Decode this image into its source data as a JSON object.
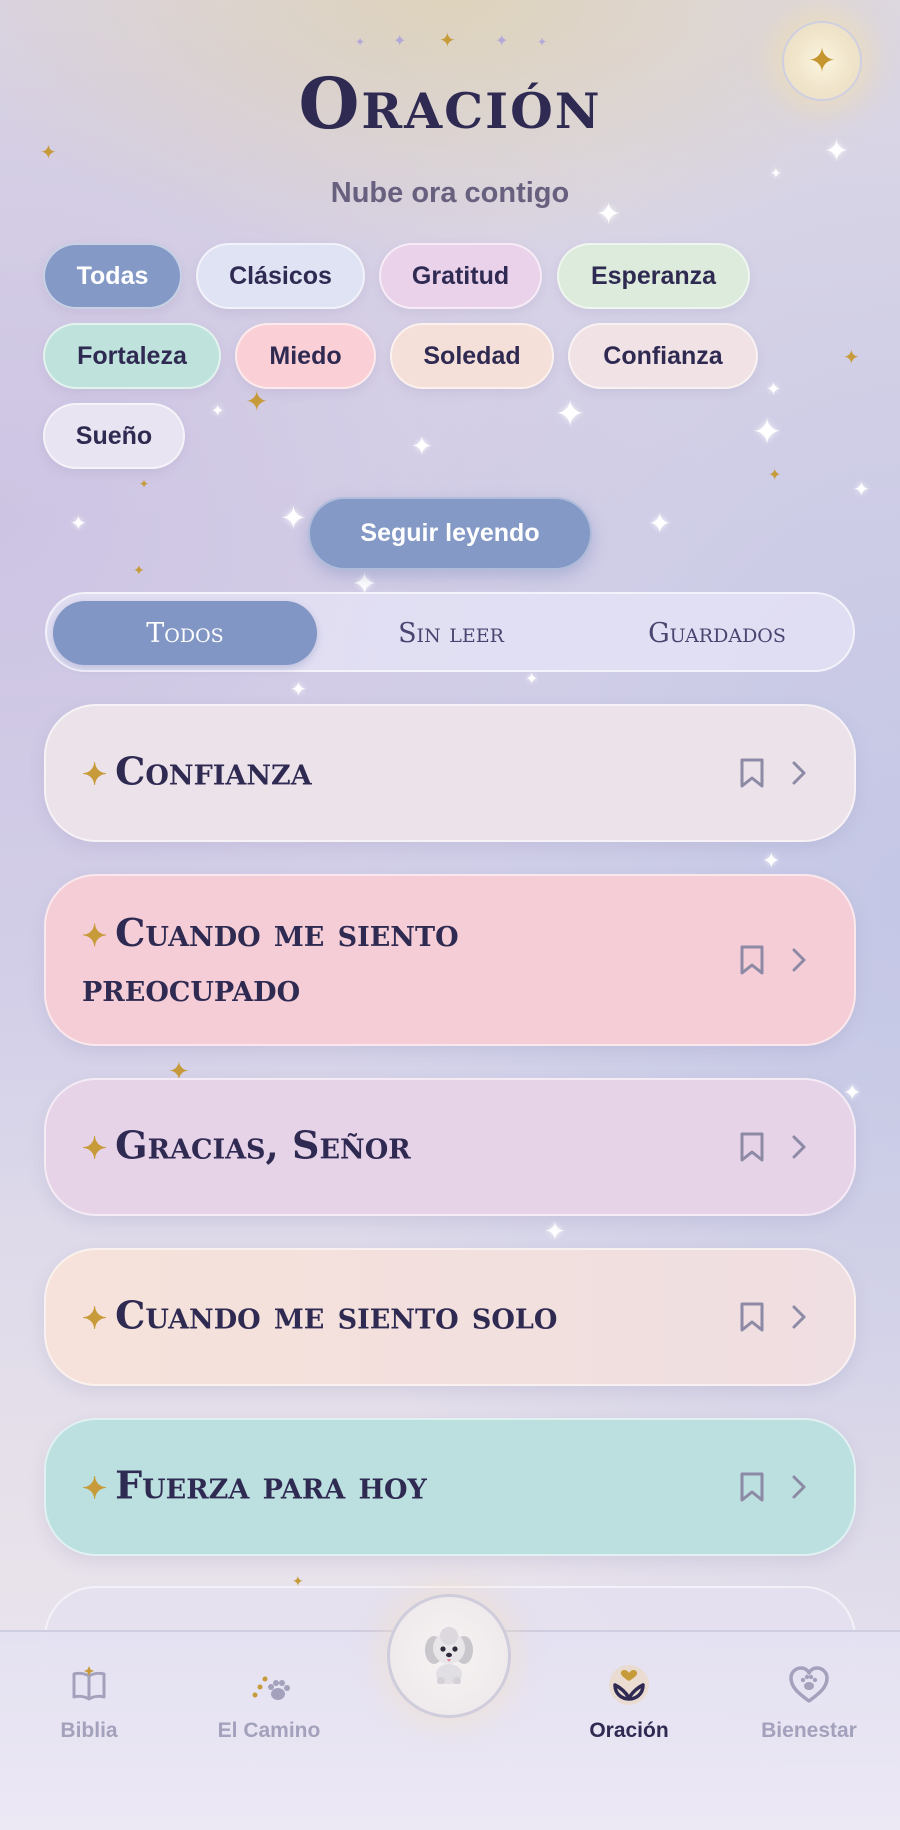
{
  "header": {
    "title": "Oración",
    "subtitle": "Nube ora contigo",
    "orb_icon": "sparkle-icon"
  },
  "filters": [
    {
      "label": "Todas",
      "color": "#8499c6",
      "active": true
    },
    {
      "label": "Clásicos",
      "color": "#dfe3f4",
      "active": false
    },
    {
      "label": "Gratitud",
      "color": "#ead2ea",
      "active": false
    },
    {
      "label": "Esperanza",
      "color": "#dcebdc",
      "active": false
    },
    {
      "label": "Fortaleza",
      "color": "#bfe3dc",
      "active": false
    },
    {
      "label": "Miedo",
      "color": "#fad0d6",
      "active": false
    },
    {
      "label": "Soledad",
      "color": "#f5dfd9",
      "active": false
    },
    {
      "label": "Confianza",
      "color": "#f1e2e5",
      "active": false
    },
    {
      "label": "Sueño",
      "color": "#e9e4f1",
      "active": false
    }
  ],
  "continue_button": "Seguir leyendo",
  "segments": [
    {
      "label": "Todos",
      "active": true
    },
    {
      "label": "Sin leer",
      "active": false
    },
    {
      "label": "Guardados",
      "active": false
    }
  ],
  "prayers": [
    {
      "title": "Confianza",
      "color": "#ece2e9",
      "icons": [
        "bookmark-icon",
        "chevron-right-icon"
      ]
    },
    {
      "title": "Cuando me siento preocupado",
      "color": "#f5cdd6",
      "icons": [
        "bookmark-icon",
        "chevron-right-icon"
      ]
    },
    {
      "title": "Gracias, Señor",
      "color": "#e7d3e8",
      "icons": [
        "bookmark-icon",
        "chevron-right-icon"
      ]
    },
    {
      "title": "Cuando me siento solo",
      "color": "#f0dfdf",
      "icons": [
        "bookmark-icon",
        "chevron-right-icon"
      ]
    },
    {
      "title": "Fuerza para hoy",
      "color": "#bcdfe0",
      "icons": [
        "bookmark-icon",
        "chevron-right-icon"
      ]
    }
  ],
  "nav": [
    {
      "label": "Biblia",
      "icon": "bible-icon",
      "active": false
    },
    {
      "label": "El Camino",
      "icon": "paw-trail-icon",
      "active": false
    },
    {
      "label": "",
      "icon": "puppy-avatar-icon",
      "active": false
    },
    {
      "label": "Oración",
      "icon": "praying-heart-icon",
      "active": true
    },
    {
      "label": "Bienestar",
      "icon": "heart-paw-icon",
      "active": false
    }
  ],
  "colors": {
    "accent": "#8499c6",
    "title": "#2f2a52",
    "gold": "#c79a3a",
    "nav_inactive": "#a3a1bb"
  }
}
